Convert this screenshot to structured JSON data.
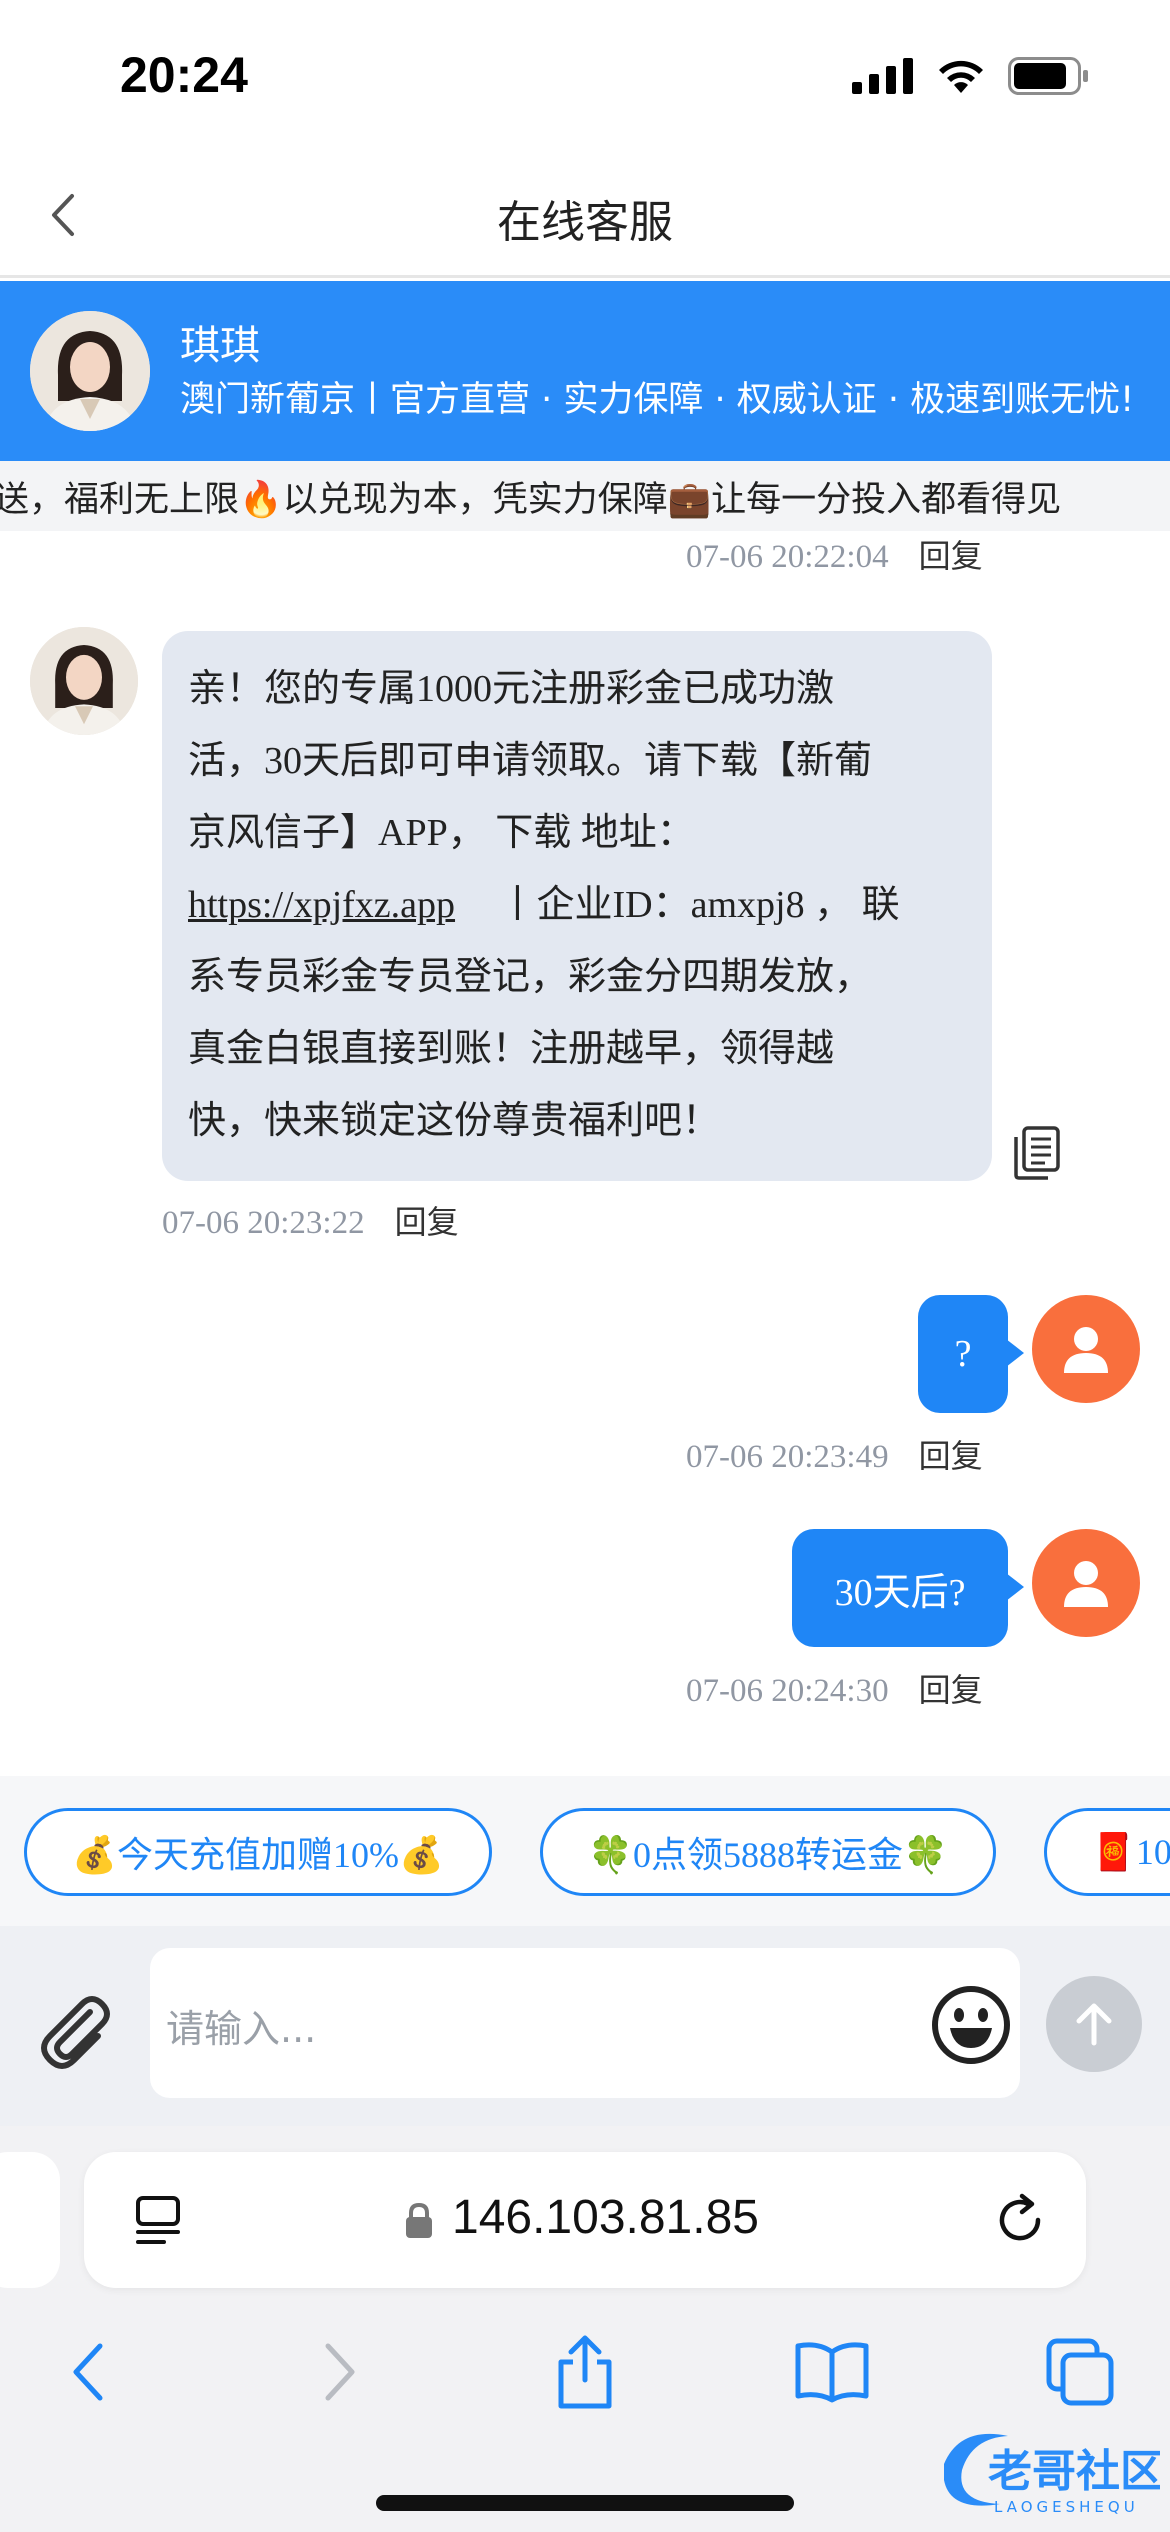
{
  "status": {
    "time": "20:24"
  },
  "header": {
    "title": "在线客服"
  },
  "agent": {
    "name": "琪琪",
    "tagline": "澳门新葡京丨官方直营 · 实力保障 · 权威认证 · 极速到账无忧!"
  },
  "marquee": {
    "text": "送，福利无上限🔥以兑现为本，凭实力保障💼让每一分投入都看得见"
  },
  "messages": [
    {
      "meta": "07-06 20:22:04",
      "reply": "回复"
    },
    {
      "lines": [
        "亲！您的专属1000元注册彩金已成功激",
        "活，30天后即可申请领取。请下载【新葡",
        "京风信子】APP， 下载 地址：",
        "https://xpjfxz.app",
        "丨企业ID：amxpj8 ， 联",
        "系专员彩金专员登记，彩金分四期发放，",
        "真金白银直接到账！注册越早，领得越",
        "快，快来锁定这份尊贵福利吧！"
      ],
      "meta": "07-06 20:23:22",
      "reply": "回复"
    },
    {
      "text": "?",
      "meta": "07-06 20:23:49",
      "reply": "回复"
    },
    {
      "text": "30天后?",
      "meta": "07-06 20:24:30",
      "reply": "回复"
    }
  ],
  "chips": [
    "💰今天充值加赠10%💰",
    "🍀0点领5888转运金🍀",
    "🧧10"
  ],
  "input": {
    "placeholder": "请输入..."
  },
  "browser": {
    "url": "146.103.81.85"
  },
  "watermark": {
    "text": "老哥社区",
    "sub": "LAOGESHEQU"
  }
}
